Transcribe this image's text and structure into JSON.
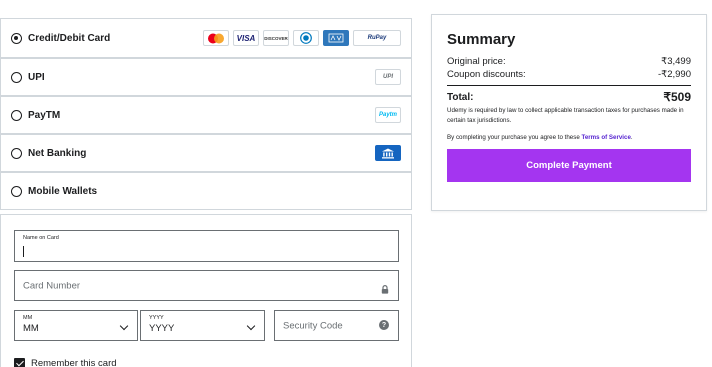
{
  "payment_methods": [
    {
      "label": "Credit/Debit Card",
      "selected": true
    },
    {
      "label": "UPI",
      "selected": false
    },
    {
      "label": "PayTM",
      "selected": false
    },
    {
      "label": "Net Banking",
      "selected": false
    },
    {
      "label": "Mobile Wallets",
      "selected": false
    }
  ],
  "card_logos": {
    "visa": "VISA",
    "discover": "DISCOVER",
    "rupay": "RuPay",
    "upi": "UPI",
    "paytm": "Paytm"
  },
  "card_form": {
    "name_label": "Name on Card",
    "name_value": "",
    "card_number_placeholder": "Card Number",
    "month_label": "MM",
    "month_value": "MM",
    "year_label": "YYYY",
    "year_value": "YYYY",
    "security_placeholder": "Security Code",
    "help_glyph": "?",
    "remember_label": "Remember this card",
    "remember_checked": true
  },
  "summary": {
    "title": "Summary",
    "original_label": "Original price:",
    "original_value": "₹3,499",
    "coupon_label": "Coupon discounts:",
    "coupon_value": "-₹2,990",
    "total_label": "Total:",
    "total_value": "₹509",
    "tax_note": "Udemy is required by law to collect applicable transaction taxes for purchases made in certain tax jurisdictions.",
    "terms_prefix": "By completing your purchase you agree to these ",
    "terms_link": "Terms of Service",
    "terms_suffix": ".",
    "button_label": "Complete Payment"
  },
  "colors": {
    "accent": "#a435f0",
    "link": "#5624d0",
    "border": "#d1d7dc",
    "text": "#1c1d1f"
  }
}
